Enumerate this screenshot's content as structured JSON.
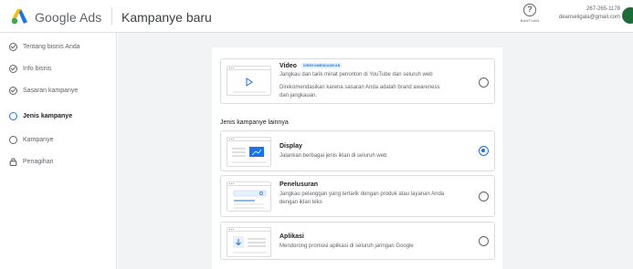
{
  "header": {
    "brand_google": "Google",
    "brand_ads": "Ads",
    "page_title": "Kampanye baru",
    "help_label": "BANTUAN",
    "account_phone": "267-265-1178",
    "account_email": "deanseligala@gmail.com"
  },
  "sidebar": {
    "items": [
      {
        "label": "Tentang bisnis Anda",
        "state": "done"
      },
      {
        "label": "Info bisnis",
        "state": "done"
      },
      {
        "label": "Sasaran kampanye",
        "state": "done"
      },
      {
        "label": "Jenis kampanye",
        "state": "active"
      },
      {
        "label": "Kampanye",
        "state": "todo"
      },
      {
        "label": "Penagihan",
        "state": "locked"
      }
    ]
  },
  "main": {
    "recommended": {
      "title": "Video",
      "badge": "DIREKOMENDASIKAN",
      "desc1": "Jangkau dan tarik minat penonton di YouTube dan seluruh web",
      "desc2": "Direkomendasikan karena sasaran Anda adalah brand awareness",
      "desc3": "dan jangkauan.",
      "selected": false
    },
    "section_label": "Jenis kampanye lainnya",
    "options": [
      {
        "title": "Display",
        "desc1": "Jalankan berbagai jenis iklan di seluruh web",
        "desc2": "",
        "selected": true
      },
      {
        "title": "Penelusuran",
        "desc1": "Jangkau pelanggan yang tertarik dengan produk atau layanan Anda",
        "desc2": "dengan iklan teks",
        "selected": false
      },
      {
        "title": "Aplikasi",
        "desc1": "Mendorong promosi aplikasi di seluruh jaringan Google",
        "desc2": "",
        "selected": false
      }
    ]
  },
  "colors": {
    "accent": "#1a73e8",
    "background": "#f1f3f4"
  }
}
